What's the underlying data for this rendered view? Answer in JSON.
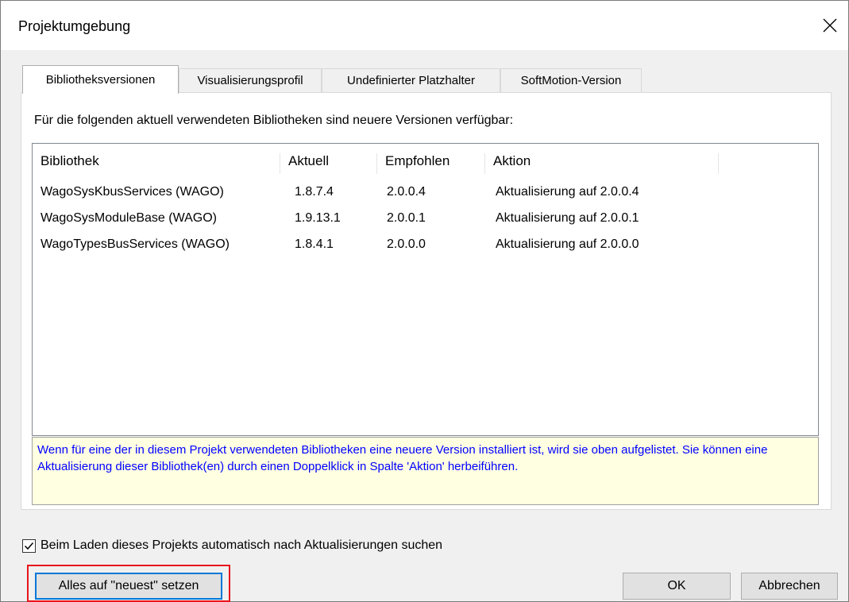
{
  "window": {
    "title": "Projektumgebung"
  },
  "tabs": [
    {
      "label": "Bibliotheksversionen",
      "active": true
    },
    {
      "label": "Visualisierungsprofil",
      "active": false
    },
    {
      "label": "Undefinierter Platzhalter",
      "active": false
    },
    {
      "label": "SoftMotion-Version",
      "active": false
    }
  ],
  "intro_text": "Für die folgenden aktuell verwendeten Bibliotheken sind neuere Versionen verfügbar:",
  "table": {
    "headers": [
      "Bibliothek",
      "Aktuell",
      "Empfohlen",
      "Aktion"
    ],
    "rows": [
      [
        "WagoSysKbusServices (WAGO)",
        "1.8.7.4",
        "2.0.0.4",
        "Aktualisierung auf 2.0.0.4"
      ],
      [
        "WagoSysModuleBase (WAGO)",
        "1.9.13.1",
        "2.0.0.1",
        "Aktualisierung auf 2.0.0.1"
      ],
      [
        "WagoTypesBusServices (WAGO)",
        "1.8.4.1",
        "2.0.0.0",
        "Aktualisierung auf 2.0.0.0"
      ]
    ]
  },
  "info_text": "Wenn für eine der in diesem Projekt verwendeten Bibliotheken  eine neuere Version installiert ist, wird sie oben aufgelistet. Sie können eine Aktualisierung dieser Bibliothek(en) durch einen Doppelklick in Spalte 'Aktion' herbeiführen.",
  "checkbox": {
    "label": "Beim Laden dieses Projekts automatisch nach Aktualisierungen suchen",
    "checked": true
  },
  "buttons": {
    "set_all_newest": "Alles auf \"neuest\" setzen",
    "ok": "OK",
    "cancel": "Abbrechen"
  },
  "colors": {
    "info_text": "#0000ff",
    "info_bg": "#ffffe1",
    "highlight": "#e8141b",
    "focus": "#0078d7"
  }
}
